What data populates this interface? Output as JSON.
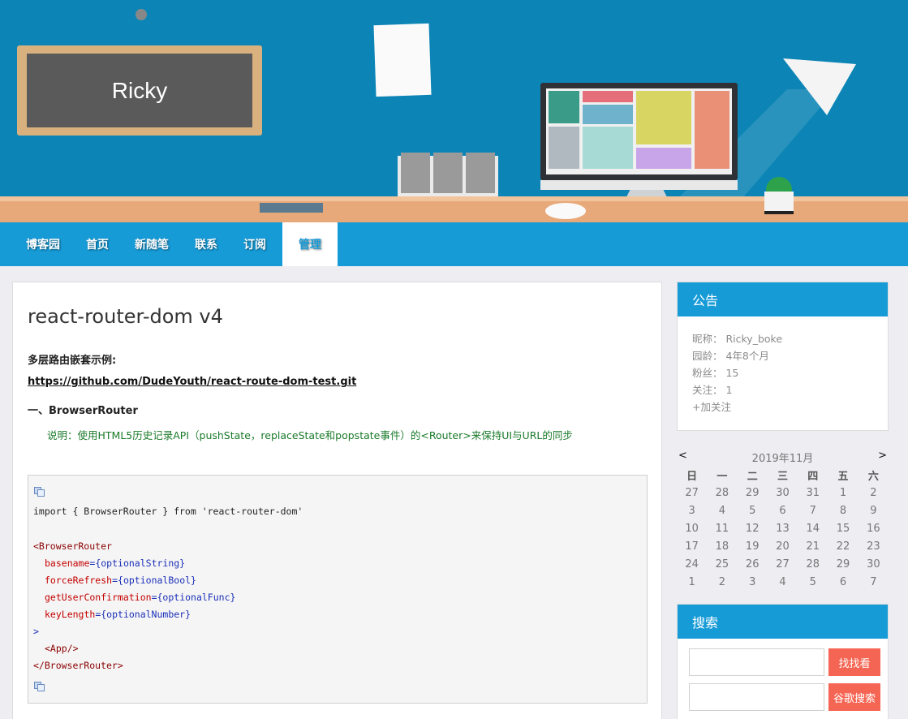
{
  "banner": {
    "title": "Ricky"
  },
  "nav": {
    "items": [
      {
        "label": "博客园"
      },
      {
        "label": "首页"
      },
      {
        "label": "新随笔"
      },
      {
        "label": "联系"
      },
      {
        "label": "订阅"
      },
      {
        "label": "管理"
      }
    ]
  },
  "post": {
    "title": "react-router-dom v4",
    "intro": "多层路由嵌套示例:",
    "link": "https://github.com/DudeYouth/react-route-dom-test.git",
    "section": "一、BrowserRouter",
    "note": "说明：使用HTML5历史记录API（pushState，replaceState和popstate事件）的<Router>来保持UI与URL的同步",
    "code": {
      "line1": "import { BrowserRouter } from 'react-router-dom'",
      "line2": "<BrowserRouter",
      "line3_attr": "basename",
      "line3_val": "{optionalString}",
      "line4_attr": "forceRefresh",
      "line4_val": "{optionalBool}",
      "line5_attr": "getUserConfirmation",
      "line5_val": "{optionalFunc}",
      "line6_attr": "keyLength",
      "line6_val": "{optionalNumber}",
      "line7": ">",
      "line8": "<App/>",
      "line9": "</BrowserRouter>"
    }
  },
  "notice": {
    "heading": "公告",
    "nickname": "昵称：  Ricky_boke",
    "age": "园龄：  4年8个月",
    "fans": "粉丝：  15",
    "follow": "关注：  1",
    "add_follow": "+加关注"
  },
  "calendar": {
    "prev": "<",
    "next": ">",
    "title": "2019年11月",
    "weekdays": [
      "日",
      "一",
      "二",
      "三",
      "四",
      "五",
      "六"
    ],
    "weeks": [
      [
        "27",
        "28",
        "29",
        "30",
        "31",
        "1",
        "2"
      ],
      [
        "3",
        "4",
        "5",
        "6",
        "7",
        "8",
        "9"
      ],
      [
        "10",
        "11",
        "12",
        "13",
        "14",
        "15",
        "16"
      ],
      [
        "17",
        "18",
        "19",
        "20",
        "21",
        "22",
        "23"
      ],
      [
        "24",
        "25",
        "26",
        "27",
        "28",
        "29",
        "30"
      ],
      [
        "1",
        "2",
        "3",
        "4",
        "5",
        "6",
        "7"
      ]
    ]
  },
  "search": {
    "heading": "搜索",
    "button1": "找找看",
    "button2": "谷歌搜索",
    "input1_value": "",
    "input2_value": ""
  },
  "colors": {
    "nav": "#179bd7",
    "banner": "#0c85b6",
    "search_button": "#f56553",
    "note_text": "#1a7a2a"
  }
}
